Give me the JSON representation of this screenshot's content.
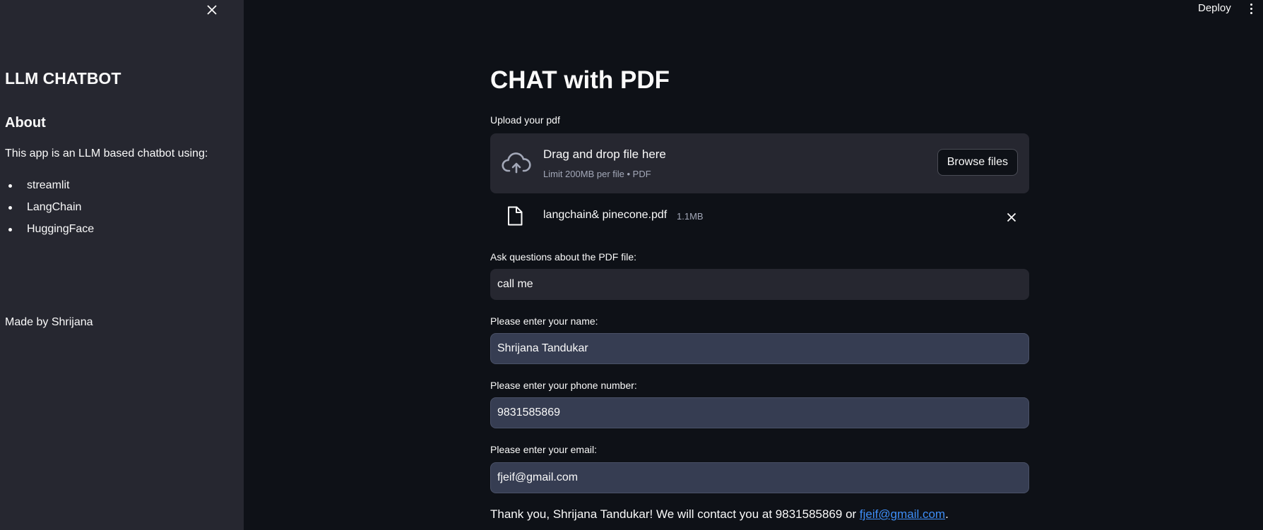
{
  "sidebar": {
    "title": "LLM CHATBOT",
    "about_heading": "About",
    "description": "This app is an LLM based chatbot using:",
    "items": [
      "streamlit",
      "LangChain",
      "HuggingFace"
    ],
    "made_by": "Made by Shrijana"
  },
  "toolbar": {
    "deploy_label": "Deploy"
  },
  "main": {
    "title": "CHAT with PDF",
    "upload_label": "Upload your pdf",
    "dropzone": {
      "main_text": "Drag and drop file here",
      "sub_text": "Limit 200MB per file • PDF",
      "browse_label": "Browse files"
    },
    "file": {
      "name": "langchain& pinecone.pdf",
      "size": "1.1MB"
    },
    "question": {
      "label": "Ask questions about the PDF file:",
      "value": "call me"
    },
    "name": {
      "label": "Please enter your name:",
      "value": "Shrijana Tandukar"
    },
    "phone": {
      "label": "Please enter your phone number:",
      "value": "9831585869"
    },
    "email": {
      "label": "Please enter your email:",
      "value": "fjeif@gmail.com"
    },
    "thanks": {
      "prefix": "Thank you, Shrijana Tandukar! We will contact you at 9831585869 or ",
      "email_link": "fjeif@gmail.com",
      "suffix": "."
    }
  },
  "colors": {
    "background": "#0e1117",
    "sidebar": "#262730",
    "input_filled": "#363d52",
    "link": "#3e8ef7"
  }
}
